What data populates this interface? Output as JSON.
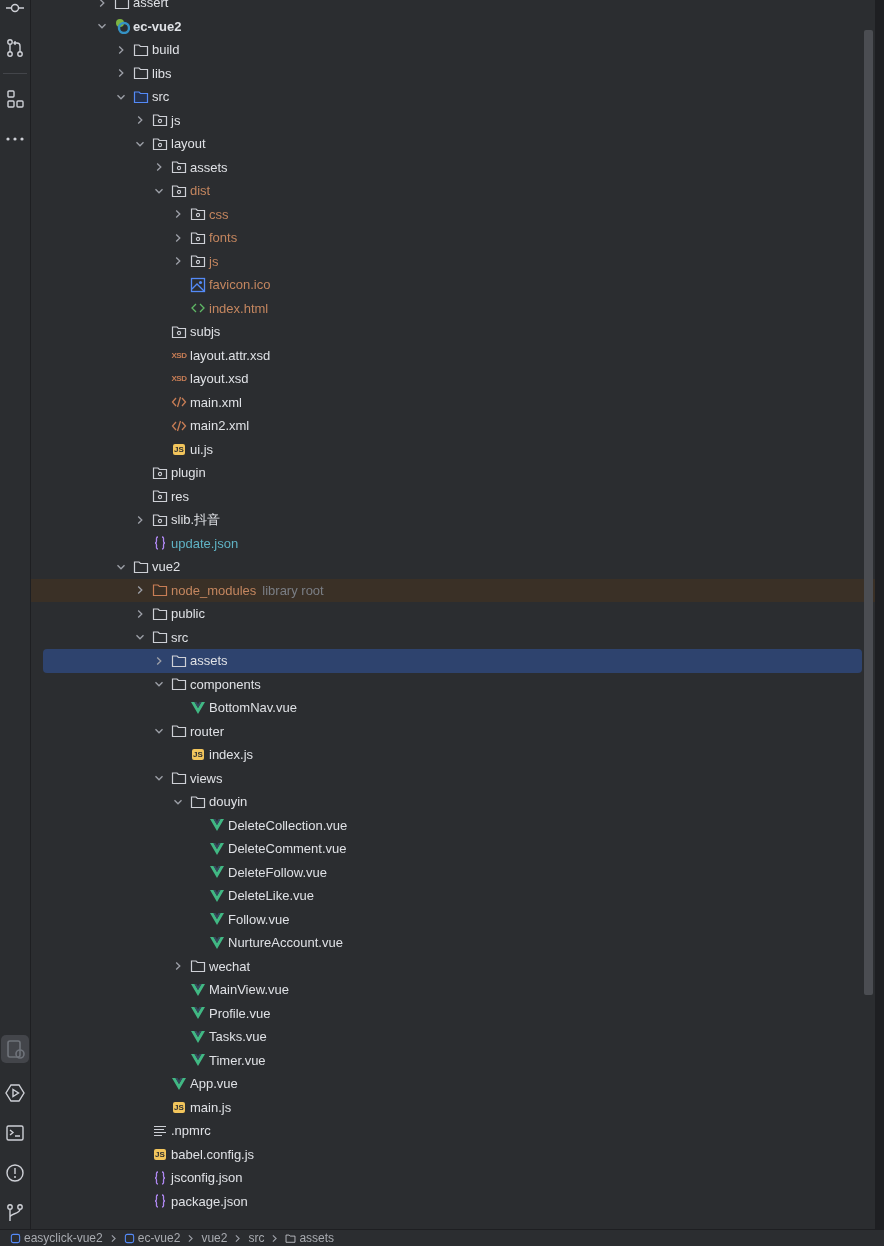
{
  "tree": [
    {
      "name": "assert",
      "kind": "folder",
      "color": "#dfe1e5",
      "expanded": false,
      "selected": false
    },
    {
      "name": "ec-vue2",
      "kind": "module",
      "color": "#dfe1e5",
      "expanded": true,
      "selected": false,
      "children": [
        {
          "name": "build",
          "kind": "folder",
          "color": "#dfe1e5",
          "expanded": false,
          "selected": false
        },
        {
          "name": "libs",
          "kind": "folder",
          "color": "#dfe1e5",
          "expanded": false,
          "selected": false
        },
        {
          "name": "src",
          "kind": "source-folder",
          "color": "#dfe1e5",
          "expanded": true,
          "selected": false,
          "children": [
            {
              "name": "js",
              "kind": "package",
              "color": "#dfe1e5",
              "expanded": false,
              "selected": false
            },
            {
              "name": "layout",
              "kind": "package",
              "color": "#dfe1e5",
              "expanded": true,
              "selected": false,
              "children": [
                {
                  "name": "assets",
                  "kind": "package",
                  "color": "#dfe1e5",
                  "expanded": false,
                  "selected": false
                },
                {
                  "name": "dist",
                  "kind": "package",
                  "color": "#c4865f",
                  "expanded": true,
                  "selected": false,
                  "children": [
                    {
                      "name": "css",
                      "kind": "package",
                      "color": "#c4865f",
                      "expanded": false,
                      "selected": false
                    },
                    {
                      "name": "fonts",
                      "kind": "package",
                      "color": "#c4865f",
                      "expanded": false,
                      "selected": false
                    },
                    {
                      "name": "js",
                      "kind": "package",
                      "color": "#c4865f",
                      "expanded": false,
                      "selected": false
                    },
                    {
                      "name": "favicon.ico",
                      "kind": "image",
                      "color": "#c4865f",
                      "selected": false
                    },
                    {
                      "name": "index.html",
                      "kind": "html",
                      "color": "#c4865f",
                      "selected": false
                    }
                  ]
                },
                {
                  "name": "subjs",
                  "kind": "package",
                  "color": "#dfe1e5",
                  "selected": false
                },
                {
                  "name": "layout.attr.xsd",
                  "kind": "xsd",
                  "icon_label": "XSD",
                  "color": "#dfe1e5",
                  "selected": false
                },
                {
                  "name": "layout.xsd",
                  "kind": "xsd",
                  "icon_label": "XSD",
                  "color": "#dfe1e5",
                  "selected": false
                },
                {
                  "name": "main.xml",
                  "kind": "xml",
                  "color": "#dfe1e5",
                  "selected": false
                },
                {
                  "name": "main2.xml",
                  "kind": "xml",
                  "color": "#dfe1e5",
                  "selected": false
                },
                {
                  "name": "ui.js",
                  "kind": "js",
                  "icon_label": "JS",
                  "color": "#dfe1e5",
                  "selected": false
                }
              ]
            },
            {
              "name": "plugin",
              "kind": "package",
              "color": "#dfe1e5",
              "selected": false
            },
            {
              "name": "res",
              "kind": "package",
              "color": "#dfe1e5",
              "selected": false
            },
            {
              "name": "slib.抖音",
              "kind": "package",
              "color": "#dfe1e5",
              "expanded": false,
              "selected": false
            },
            {
              "name": "update.json",
              "kind": "json",
              "color": "#5fb2c4",
              "selected": false
            }
          ]
        },
        {
          "name": "vue2",
          "kind": "folder",
          "color": "#dfe1e5",
          "expanded": true,
          "selected": false,
          "children": [
            {
              "name": "node_modules",
              "kind": "library-folder",
              "color": "#c4865f",
              "hint": "library root",
              "expanded": false,
              "selected": false
            },
            {
              "name": "public",
              "kind": "folder",
              "color": "#dfe1e5",
              "expanded": false,
              "selected": false
            },
            {
              "name": "src",
              "kind": "folder",
              "color": "#dfe1e5",
              "expanded": true,
              "selected": false,
              "children": [
                {
                  "name": "assets",
                  "kind": "folder",
                  "color": "#dfe1e5",
                  "expanded": false,
                  "selected": true
                },
                {
                  "name": "components",
                  "kind": "folder",
                  "color": "#dfe1e5",
                  "expanded": true,
                  "selected": false,
                  "children": [
                    {
                      "name": "BottomNav.vue",
                      "kind": "vue",
                      "color": "#dfe1e5",
                      "selected": false
                    }
                  ]
                },
                {
                  "name": "router",
                  "kind": "folder",
                  "color": "#dfe1e5",
                  "expanded": true,
                  "selected": false,
                  "children": [
                    {
                      "name": "index.js",
                      "kind": "js",
                      "icon_label": "JS",
                      "color": "#dfe1e5",
                      "selected": false
                    }
                  ]
                },
                {
                  "name": "views",
                  "kind": "folder",
                  "color": "#dfe1e5",
                  "expanded": true,
                  "selected": false,
                  "children": [
                    {
                      "name": "douyin",
                      "kind": "folder",
                      "color": "#dfe1e5",
                      "expanded": true,
                      "selected": false,
                      "children": [
                        {
                          "name": "DeleteCollection.vue",
                          "kind": "vue",
                          "color": "#dfe1e5",
                          "selected": false
                        },
                        {
                          "name": "DeleteComment.vue",
                          "kind": "vue",
                          "color": "#dfe1e5",
                          "selected": false
                        },
                        {
                          "name": "DeleteFollow.vue",
                          "kind": "vue",
                          "color": "#dfe1e5",
                          "selected": false
                        },
                        {
                          "name": "DeleteLike.vue",
                          "kind": "vue",
                          "color": "#dfe1e5",
                          "selected": false
                        },
                        {
                          "name": "Follow.vue",
                          "kind": "vue",
                          "color": "#dfe1e5",
                          "selected": false
                        },
                        {
                          "name": "NurtureAccount.vue",
                          "kind": "vue",
                          "color": "#dfe1e5",
                          "selected": false
                        }
                      ]
                    },
                    {
                      "name": "wechat",
                      "kind": "folder",
                      "color": "#dfe1e5",
                      "expanded": false,
                      "selected": false
                    },
                    {
                      "name": "MainView.vue",
                      "kind": "vue",
                      "color": "#dfe1e5",
                      "selected": false
                    },
                    {
                      "name": "Profile.vue",
                      "kind": "vue",
                      "color": "#dfe1e5",
                      "selected": false
                    },
                    {
                      "name": "Tasks.vue",
                      "kind": "vue",
                      "color": "#dfe1e5",
                      "selected": false
                    },
                    {
                      "name": "Timer.vue",
                      "kind": "vue",
                      "color": "#dfe1e5",
                      "selected": false
                    }
                  ]
                },
                {
                  "name": "App.vue",
                  "kind": "vue",
                  "color": "#dfe1e5",
                  "selected": false
                },
                {
                  "name": "main.js",
                  "kind": "js",
                  "icon_label": "JS",
                  "color": "#dfe1e5",
                  "selected": false
                }
              ]
            },
            {
              "name": ".npmrc",
              "kind": "text",
              "color": "#dfe1e5",
              "selected": false
            },
            {
              "name": "babel.config.js",
              "kind": "js",
              "icon_label": "JS",
              "color": "#dfe1e5",
              "selected": false
            },
            {
              "name": "jsconfig.json",
              "kind": "json",
              "color": "#dfe1e5",
              "selected": false
            },
            {
              "name": "package.json",
              "kind": "json",
              "color": "#dfe1e5",
              "selected": false
            }
          ]
        }
      ]
    }
  ],
  "breadcrumb": [
    {
      "label": "easyclick-vue2",
      "kind": "module"
    },
    {
      "label": "ec-vue2",
      "kind": "module"
    },
    {
      "label": "vue2",
      "kind": "plain"
    },
    {
      "label": "src",
      "kind": "plain"
    },
    {
      "label": "assets",
      "kind": "folder"
    }
  ]
}
